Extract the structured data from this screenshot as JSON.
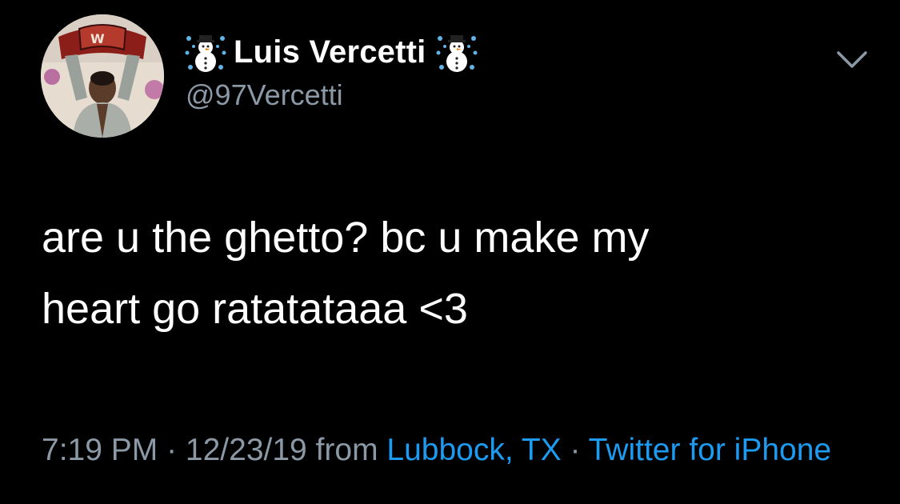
{
  "tweet": {
    "author": {
      "display_name": "Luis Vercetti",
      "name_emoji": "snowman-with-snowflakes",
      "handle": "@97Vercetti",
      "avatar_icon": "avatar-photo-holding-belt"
    },
    "menu_icon": "chevron-down-icon",
    "text": "are u the ghetto? bc u make my\nheart go ratatataaa <3",
    "meta": {
      "time": "7:19 PM",
      "separator_1": " · ",
      "date": "12/23/19",
      "from_label": " from ",
      "location": "Lubbock, TX",
      "separator_2": " · ",
      "source": "Twitter for iPhone"
    }
  },
  "colors": {
    "background": "#000000",
    "text_primary": "#ffffff",
    "text_secondary": "#8b98a5",
    "link": "#1d9bf0"
  }
}
